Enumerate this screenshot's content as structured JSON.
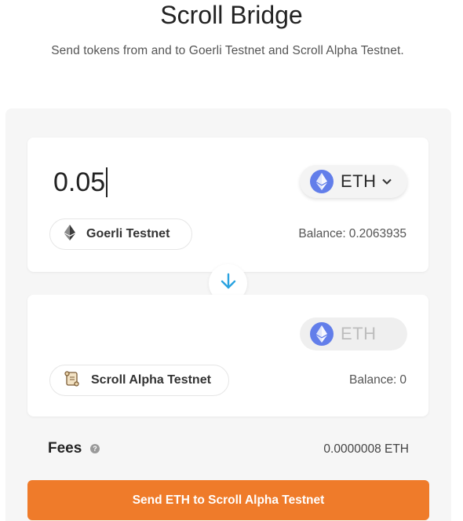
{
  "header": {
    "title": "Scroll Bridge",
    "subtitle": "Send tokens from and to Goerli Testnet and Scroll Alpha Testnet."
  },
  "from": {
    "amount": "0.05",
    "token": "ETH",
    "token_icon": "ethereum-icon",
    "network": "Goerli Testnet",
    "network_icon": "ethereum-logo-icon",
    "balance_label": "Balance:",
    "balance_value": "0.2063935"
  },
  "to": {
    "token": "ETH",
    "token_icon": "ethereum-icon",
    "network": "Scroll Alpha Testnet",
    "network_icon": "scroll-icon",
    "balance_label": "Balance:",
    "balance_value": "0"
  },
  "swap_icon": "arrow-down-icon",
  "fees": {
    "label": "Fees",
    "value": "0.0000008 ETH"
  },
  "send_button_label": "Send ETH to Scroll Alpha Testnet",
  "colors": {
    "accent": "#ef7b2a",
    "eth": "#627eea",
    "arrow": "#2aa3e0"
  }
}
